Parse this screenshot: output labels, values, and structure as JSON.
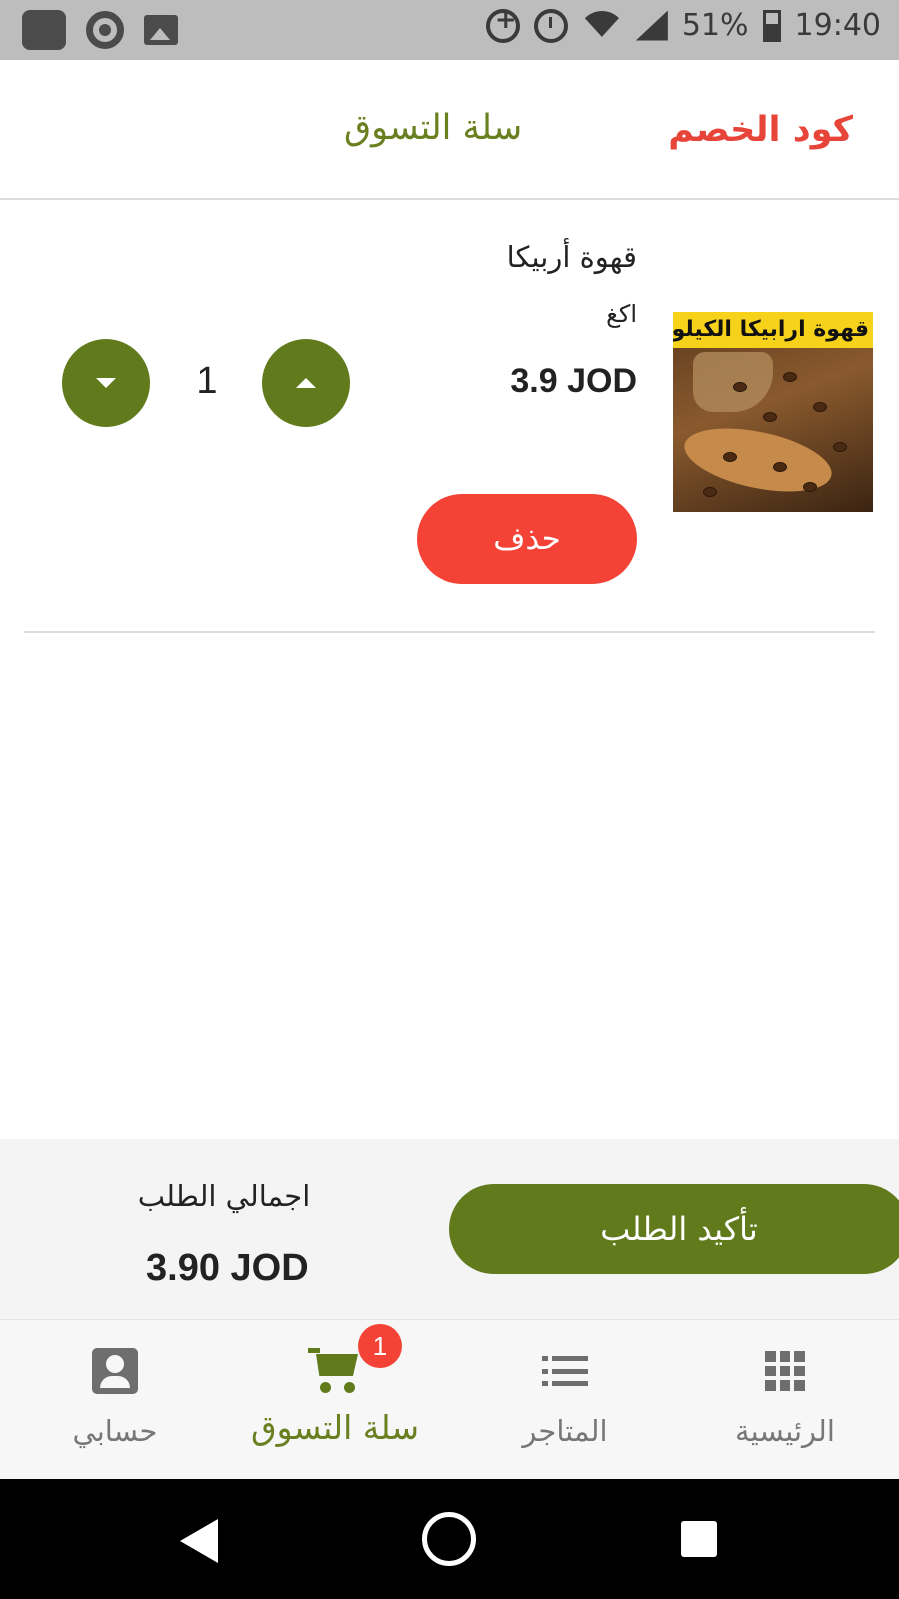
{
  "status_bar": {
    "battery": "51%",
    "time": "19:40",
    "icons": [
      "app-icon",
      "chrome-icon",
      "image-icon",
      "data-saver-icon",
      "alarm-icon",
      "wifi-icon",
      "signal-icon",
      "battery-icon"
    ]
  },
  "header": {
    "title": "سلة التسوق",
    "discount_code": "كود الخصم"
  },
  "cart": {
    "items": [
      {
        "name": "قهوة أربيكا",
        "unit": "اكغ",
        "price": "3.9 JOD",
        "quantity": "1",
        "image_banner": "قهوة ارابيكا الكيلو ب",
        "delete_label": "حذف"
      }
    ]
  },
  "summary": {
    "confirm_label": "تأكيد الطلب",
    "total_label": "اجمالي الطلب",
    "total_value": "3.90 JOD"
  },
  "bottom_nav": {
    "items": [
      {
        "label": "حسابي",
        "icon": "account-icon",
        "active": false
      },
      {
        "label": "سلة التسوق",
        "icon": "cart-icon",
        "active": true,
        "badge": "1"
      },
      {
        "label": "المتاجر",
        "icon": "list-icon",
        "active": false
      },
      {
        "label": "الرئيسية",
        "icon": "grid-icon",
        "active": false
      }
    ]
  },
  "colors": {
    "primary_green": "#607a1c",
    "accent_red": "#f44336",
    "title_green": "#6a7f1f"
  }
}
